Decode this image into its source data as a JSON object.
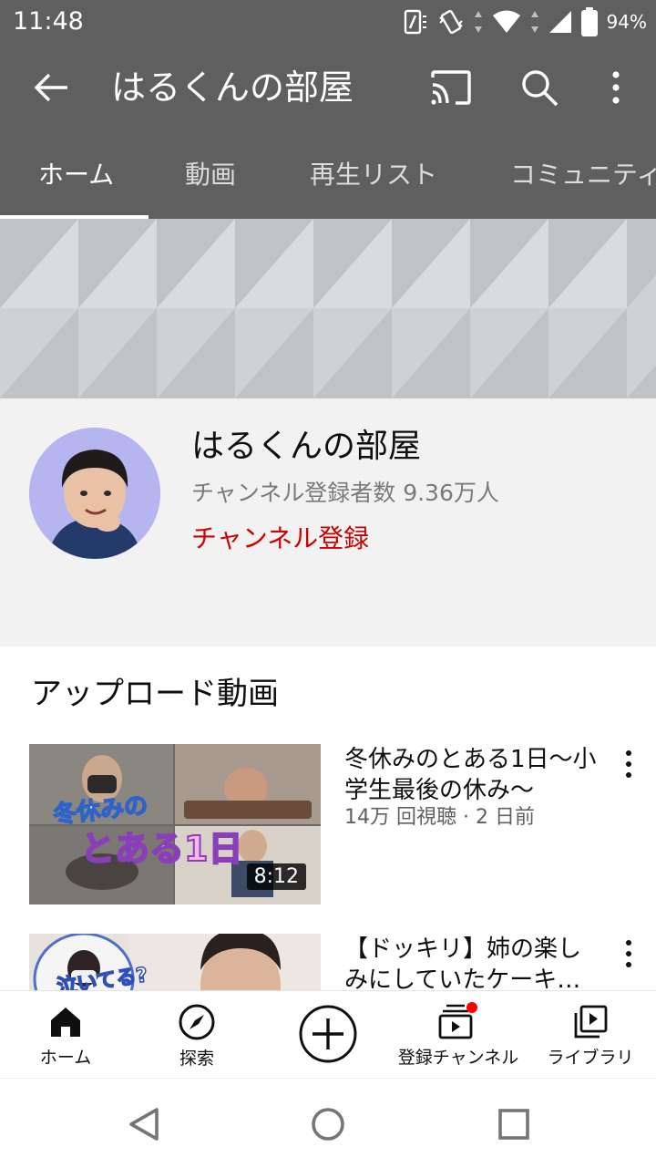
{
  "status_bar": {
    "time": "11:48",
    "battery": "94%"
  },
  "app_bar": {
    "title": "はるくんの部屋"
  },
  "tabs": [
    {
      "label": "ホーム",
      "active": true
    },
    {
      "label": "動画"
    },
    {
      "label": "再生リスト"
    },
    {
      "label": "コミュニティ"
    }
  ],
  "channel": {
    "name": "はるくんの部屋",
    "subscribers": "チャンネル登録者数 9.36万人",
    "subscribe_label": "チャンネル登録",
    "subscribe_color": "#cc0000"
  },
  "uploads": {
    "title": "アップロード動画",
    "videos": [
      {
        "title": "冬休みのとある1日〜小学生最後の休み〜",
        "meta": "14万 回視聴 · 2 日前",
        "duration": "8:12",
        "thumb_text_1": "冬休みの",
        "thumb_text_2": "とある1日"
      },
      {
        "title": "【ドッキリ】姉の楽しみにしていたケーキ…",
        "thumb_text_1": "泣いてる?"
      }
    ]
  },
  "bottom_nav": [
    {
      "label": "ホーム",
      "icon": "home-icon"
    },
    {
      "label": "探索",
      "icon": "explore-icon"
    },
    {
      "label": "",
      "icon": "create-icon"
    },
    {
      "label": "登録チャンネル",
      "icon": "subscriptions-icon"
    },
    {
      "label": "ライブラリ",
      "icon": "library-icon"
    }
  ],
  "colors": {
    "app_bar": "#5f5f5f",
    "accent_red": "#cc0000"
  }
}
